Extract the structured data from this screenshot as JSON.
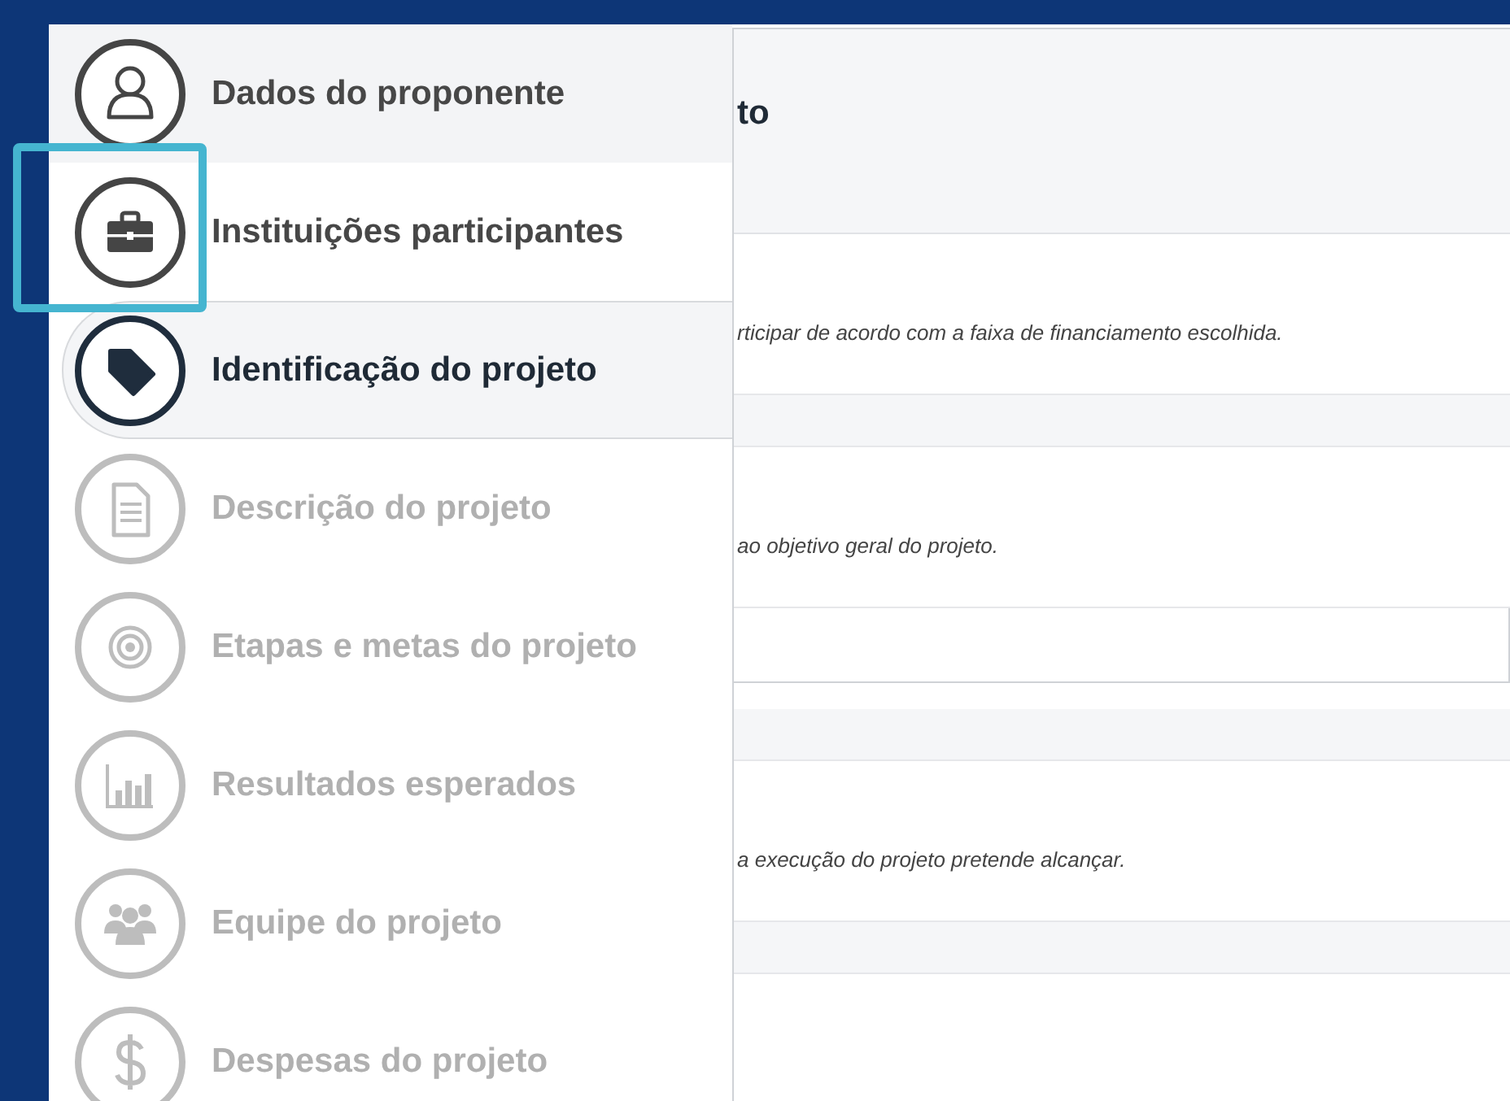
{
  "sidebar": {
    "items": [
      {
        "label": "Dados do proponente",
        "kind": "user",
        "selected": false,
        "disabled": false,
        "hovered": true
      },
      {
        "label": "Instituições participantes",
        "kind": "briefcase",
        "selected": false,
        "disabled": false,
        "hovered": false
      },
      {
        "label": "Identificação do projeto",
        "kind": "tag",
        "selected": true,
        "disabled": false,
        "hovered": false
      },
      {
        "label": "Descrição do projeto",
        "kind": "document",
        "selected": false,
        "disabled": true,
        "hovered": false
      },
      {
        "label": "Etapas e metas do projeto",
        "kind": "target",
        "selected": false,
        "disabled": true,
        "hovered": false
      },
      {
        "label": "Resultados esperados",
        "kind": "chart",
        "selected": false,
        "disabled": true,
        "hovered": false
      },
      {
        "label": "Equipe do projeto",
        "kind": "group",
        "selected": false,
        "disabled": true,
        "hovered": false
      },
      {
        "label": "Despesas do projeto",
        "kind": "dollar",
        "selected": false,
        "disabled": true,
        "hovered": false
      }
    ]
  },
  "main": {
    "rows": [
      {
        "kind": "header",
        "text": "to"
      },
      {
        "kind": "text",
        "text": "rticipar de acordo com a faixa de financiamento escolhida."
      },
      {
        "kind": "band"
      },
      {
        "kind": "text",
        "text": "ao objetivo geral do projeto."
      },
      {
        "kind": "field"
      },
      {
        "kind": "band"
      },
      {
        "kind": "text",
        "text": "a execução do projeto pretende alcançar."
      },
      {
        "kind": "band"
      }
    ]
  }
}
